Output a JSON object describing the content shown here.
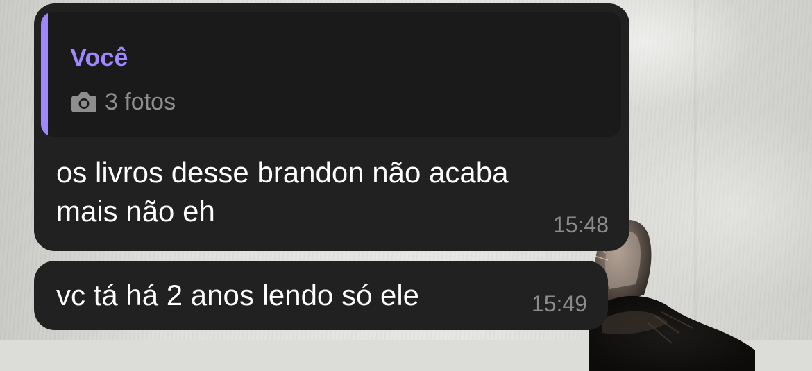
{
  "colors": {
    "bubble_background": "#212121",
    "reply_background": "#1a1a1a",
    "reply_accent": "#a187ff",
    "message_text": "#ffffff",
    "secondary_text": "#8e8e8e"
  },
  "messages": [
    {
      "reply": {
        "author": "Você",
        "icon": "camera-icon",
        "text": "3 fotos"
      },
      "text": "os livros desse brandon não acaba\nmais não eh",
      "time": "15:48"
    },
    {
      "text": "vc tá há 2 anos lendo só ele",
      "time": "15:49"
    }
  ]
}
